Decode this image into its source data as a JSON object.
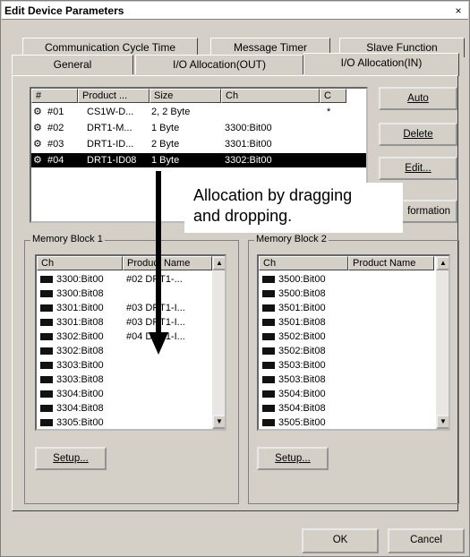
{
  "window": {
    "title": "Edit Device Parameters",
    "close": "×"
  },
  "tabs": {
    "row1": [
      "Communication Cycle Time",
      "Message Timer",
      "Slave Function"
    ],
    "row2": [
      "General",
      "I/O Allocation(OUT)",
      "I/O Allocation(IN)"
    ]
  },
  "device_list": {
    "headers": [
      "#",
      "Product ...",
      "Size",
      "Ch",
      "C"
    ],
    "rows": [
      {
        "num": "#01",
        "product": "CS1W-D...",
        "size": "2, 2 Byte",
        "ch": "",
        "c": "*"
      },
      {
        "num": "#02",
        "product": "DRT1-M...",
        "size": "1 Byte",
        "ch": "3300:Bit00",
        "c": ""
      },
      {
        "num": "#03",
        "product": "DRT1-ID...",
        "size": "2 Byte",
        "ch": "3301:Bit00",
        "c": ""
      },
      {
        "num": "#04",
        "product": "DRT1-ID08",
        "size": "1 Byte",
        "ch": "3302:Bit00",
        "c": ""
      }
    ]
  },
  "buttons": {
    "auto": "Auto",
    "delete": "Delete",
    "edit": "Edit...",
    "information": "formation",
    "setup1": "Setup...",
    "setup2": "Setup...",
    "ok": "OK",
    "cancel": "Cancel"
  },
  "annotation": {
    "line1": "Allocation by dragging",
    "line2": "and dropping."
  },
  "memory_block_1": {
    "label": "Memory Block 1",
    "headers": [
      "Ch",
      "Product Name"
    ],
    "rows": [
      {
        "ch": "3300:Bit00",
        "name": "#02 DRT1-..."
      },
      {
        "ch": "3300:Bit08",
        "name": ""
      },
      {
        "ch": "3301:Bit00",
        "name": "#03 DRT1-I..."
      },
      {
        "ch": "3301:Bit08",
        "name": "#03 DRT1-I..."
      },
      {
        "ch": "3302:Bit00",
        "name": "#04 DRT1-I..."
      },
      {
        "ch": "3302:Bit08",
        "name": ""
      },
      {
        "ch": "3303:Bit00",
        "name": ""
      },
      {
        "ch": "3303:Bit08",
        "name": ""
      },
      {
        "ch": "3304:Bit00",
        "name": ""
      },
      {
        "ch": "3304:Bit08",
        "name": ""
      },
      {
        "ch": "3305:Bit00",
        "name": ""
      }
    ]
  },
  "memory_block_2": {
    "label": "Memory Block 2",
    "headers": [
      "Ch",
      "Product Name"
    ],
    "rows": [
      {
        "ch": "3500:Bit00",
        "name": ""
      },
      {
        "ch": "3500:Bit08",
        "name": ""
      },
      {
        "ch": "3501:Bit00",
        "name": ""
      },
      {
        "ch": "3501:Bit08",
        "name": ""
      },
      {
        "ch": "3502:Bit00",
        "name": ""
      },
      {
        "ch": "3502:Bit08",
        "name": ""
      },
      {
        "ch": "3503:Bit00",
        "name": ""
      },
      {
        "ch": "3503:Bit08",
        "name": ""
      },
      {
        "ch": "3504:Bit00",
        "name": ""
      },
      {
        "ch": "3504:Bit08",
        "name": ""
      },
      {
        "ch": "3505:Bit00",
        "name": ""
      }
    ]
  }
}
